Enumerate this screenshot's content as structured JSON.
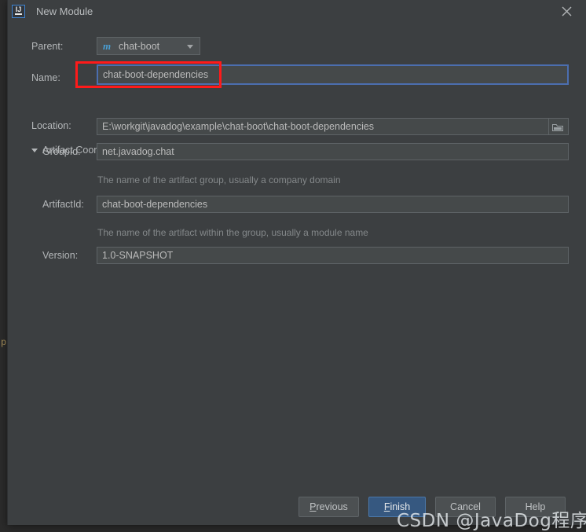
{
  "backdrop": {
    "gutter_char": "p"
  },
  "dialog": {
    "title": "New Module",
    "app_icon": "intellij-idea-icon",
    "close_icon": "close-icon"
  },
  "form": {
    "parent": {
      "label": "Parent:",
      "icon": "maven-module-icon",
      "icon_glyph": "m",
      "value": "chat-boot",
      "arrow_icon": "chevron-down-icon"
    },
    "name": {
      "label": "Name:",
      "value": "chat-boot-dependencies",
      "focused": true
    },
    "location": {
      "label": "Location:",
      "value": "E:\\workgit\\javadog\\example\\chat-boot\\chat-boot-dependencies",
      "browse_icon": "folder-icon"
    },
    "artifact_section": {
      "label": "Artifact Coordinates",
      "expanded": true,
      "triangle_icon": "triangle-down-icon"
    },
    "group_id": {
      "label": "GroupId:",
      "value": "net.javadog.chat",
      "hint": "The name of the artifact group, usually a company domain"
    },
    "artifact_id": {
      "label": "ArtifactId:",
      "value": "chat-boot-dependencies",
      "hint": "The name of the artifact within the group, usually a module name"
    },
    "version": {
      "label": "Version:",
      "value": "1.0-SNAPSHOT"
    }
  },
  "buttons": {
    "previous": {
      "prefix": "",
      "mnemonic": "P",
      "suffix": "revious"
    },
    "finish": {
      "prefix": "",
      "mnemonic": "F",
      "suffix": "inish"
    },
    "cancel": {
      "prefix": "",
      "mnemonic": "C",
      "suffix": "ancel"
    },
    "help": {
      "prefix": "",
      "mnemonic": "H",
      "suffix": "elp"
    }
  },
  "annotation": {
    "target": "name-field",
    "color": "#ff1a1a"
  },
  "watermark": {
    "text": "CSDN @JavaDog程序狗"
  },
  "colors": {
    "dialog_bg": "#3c3f41",
    "field_bg": "#45494a",
    "focus_border": "#4b6eaf",
    "primary_button": "#365880",
    "text": "#b3b6b8",
    "hint_text": "#84888a",
    "accent_icon": "#4a9fd4"
  }
}
